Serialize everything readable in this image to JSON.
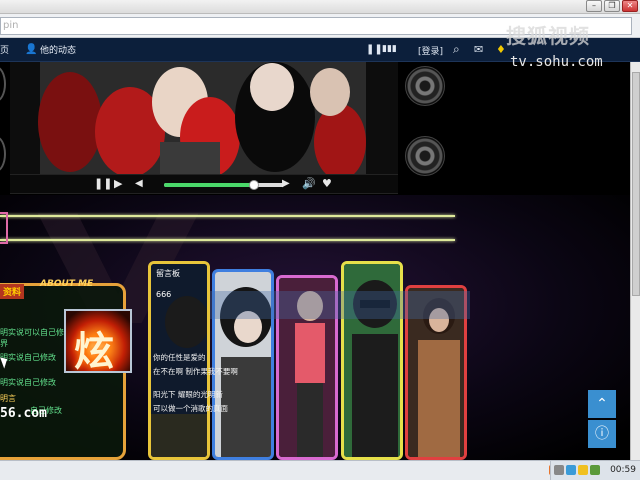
{
  "browser": {
    "url_fragment": "pin"
  },
  "nav": {
    "home_frag": "页",
    "his_activity": "他的动态",
    "login": "[登录]"
  },
  "brand": {
    "logo_text": "搜狐视频",
    "url": "tv.sohu.com"
  },
  "about": {
    "title": "ABOUT ME",
    "tag": "资料",
    "lines": [
      "明实说可以自己修改",
      "界",
      "明实说自己修改",
      "明实说自己修改",
      "明言"
    ],
    "edit_line": "自己修改",
    "site_url": "56.com"
  },
  "message_board": {
    "title": "留言板",
    "count": "666",
    "lines": [
      "你的任性是爱的",
      "在不在啊 制作果我不要啊",
      "阳光下 耀眼的光明新",
      "可以做一个消歌的真面"
    ]
  },
  "taskbar": {
    "clock": "00:59"
  },
  "colors": {
    "nav_bg": "#0c1f3b",
    "accent_green": "#4bd86a",
    "side_button": "#3a8fd0"
  },
  "video": {
    "progress": 0.75
  }
}
